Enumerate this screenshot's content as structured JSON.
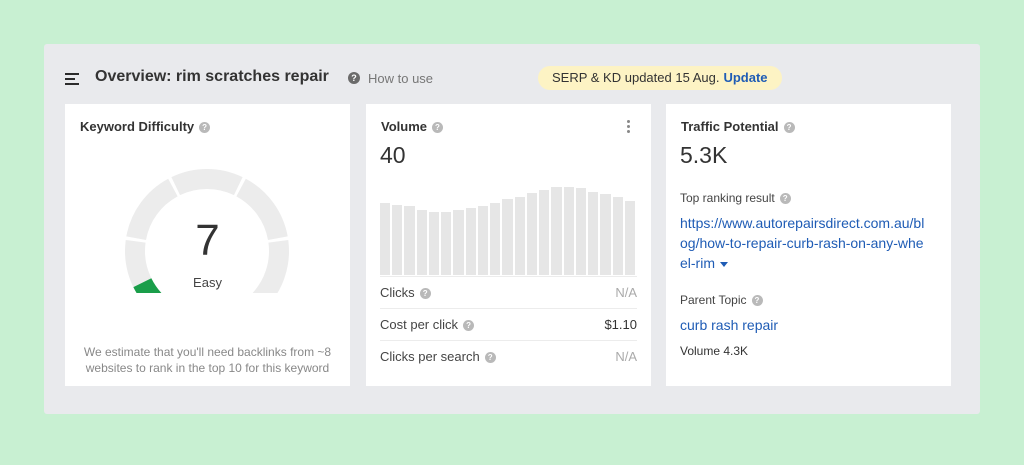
{
  "header": {
    "title": "Overview: rim scratches repair",
    "how_to_use": "How to use",
    "notice": "SERP & KD updated 15 Aug.",
    "update_label": "Update"
  },
  "keyword_difficulty": {
    "label": "Keyword Difficulty",
    "value": 7,
    "value_text": "7",
    "rating": "Easy",
    "note": "We estimate that you'll need backlinks from ~8 websites to rank in the top 10 for this keyword",
    "gauge_color": "#1a9e4a",
    "track_color": "#ececec"
  },
  "volume": {
    "label": "Volume",
    "value": "40",
    "trend": [
      78,
      76,
      74,
      70,
      68,
      68,
      70,
      72,
      75,
      78,
      82,
      84,
      88,
      92,
      95,
      95,
      94,
      90,
      87,
      84,
      80
    ],
    "metrics": [
      {
        "label": "Clicks",
        "value": "N/A",
        "muted": true
      },
      {
        "label": "Cost per click",
        "value": "$1.10",
        "muted": false
      },
      {
        "label": "Clicks per search",
        "value": "N/A",
        "muted": true
      }
    ]
  },
  "traffic_potential": {
    "label": "Traffic Potential",
    "value": "5.3K",
    "top_result_label": "Top ranking result",
    "top_result_line1": "https://www.autorepairsdirect.com.au/bl",
    "top_result_line2": "og/how-to-repair-curb-rash-on-any-whe",
    "top_result_line3": "el-rim",
    "parent_topic_label": "Parent Topic",
    "parent_topic": "curb rash repair",
    "parent_volume": "Volume 4.3K"
  },
  "colors": {
    "background": "#c8f0d2",
    "panel": "#e9eaed",
    "link": "#1f5cb5",
    "pill": "#fdf3c4"
  }
}
